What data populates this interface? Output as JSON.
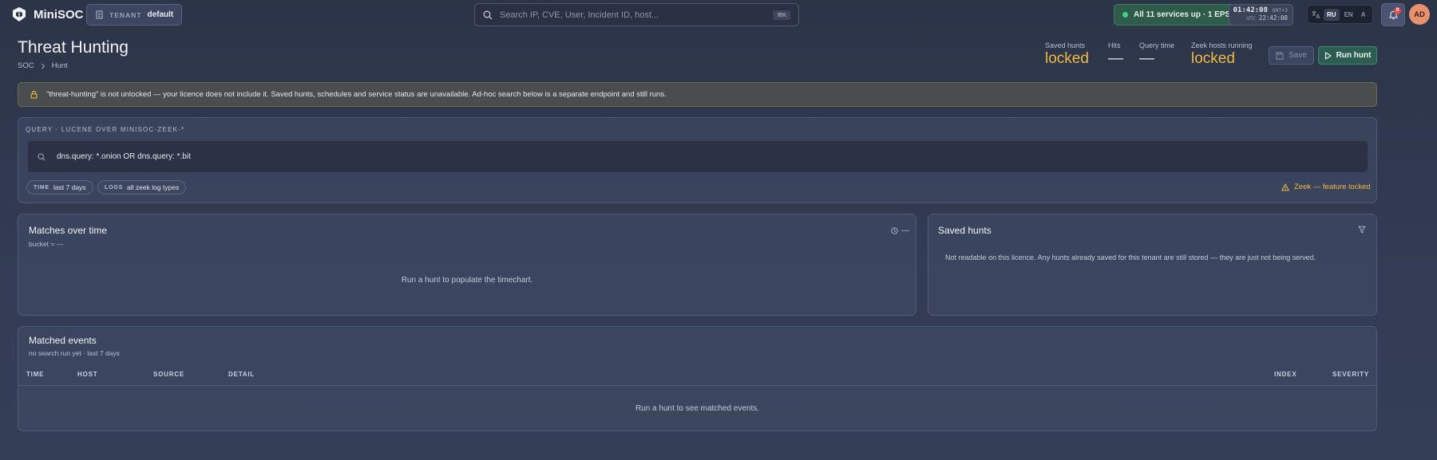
{
  "app": {
    "name": "MiniSOC"
  },
  "tenant": {
    "label": "TENANT",
    "value": "default"
  },
  "search": {
    "placeholder": "Search IP, CVE, User, Incident ID, host...",
    "shortcut": "⌘K"
  },
  "status": {
    "text": "All 11 services up · 1 EPS"
  },
  "clock": {
    "local_time": "01:42:08",
    "local_zone": "GMT+3",
    "utc_label": "UTC",
    "utc_time": "22:42:08"
  },
  "languages": [
    {
      "label": "RU",
      "active": true
    },
    {
      "label": "EN",
      "active": false
    },
    {
      "label": "A",
      "active": false
    }
  ],
  "notifications": {
    "count": "9"
  },
  "user": {
    "initials": "AD"
  },
  "page": {
    "title": "Threat Hunting",
    "breadcrumb": [
      "SOC",
      "Hunt"
    ]
  },
  "stats": [
    {
      "label": "Saved hunts",
      "value": "locked"
    },
    {
      "label": "Hits",
      "value": "—"
    },
    {
      "label": "Query time",
      "value": "—"
    },
    {
      "label": "Zeek hosts running",
      "value": "locked"
    }
  ],
  "actions": {
    "save": "Save",
    "run": "Run hunt"
  },
  "warning": "\"threat-hunting\" is not unlocked — your licence does not include it. Saved hunts, schedules and service status are unavailable. Ad-hoc search below is a separate endpoint and still runs.",
  "query": {
    "label": "QUERY · LUCENE OVER MINISOC-ZEEK-*",
    "value": "dns.query: *.onion OR dns.query: *.bit",
    "chips": [
      {
        "key": "TIME",
        "value": "last 7 days"
      },
      {
        "key": "LOGS",
        "value": "all zeek log types"
      }
    ],
    "zeek_notice": "Zeek — feature locked"
  },
  "matches_over_time": {
    "title": "Matches over time",
    "bucket": "bucket = —",
    "control": "—",
    "empty": "Run a hunt to populate the timechart."
  },
  "saved_hunts": {
    "title": "Saved hunts",
    "message": "Not readable on this licence. Any hunts already saved for this tenant are still stored — they are just not being served."
  },
  "matched_events": {
    "title": "Matched events",
    "subtitle": "no search run yet · last 7 days",
    "columns": [
      "TIME",
      "HOST",
      "SOURCE",
      "DETAIL",
      "INDEX",
      "SEVERITY"
    ],
    "empty": "Run a hunt to see matched events."
  },
  "colors": {
    "accent_green": "#3ed37f",
    "locked_amber": "#f0b942",
    "alert_red": "#e64a4a"
  }
}
